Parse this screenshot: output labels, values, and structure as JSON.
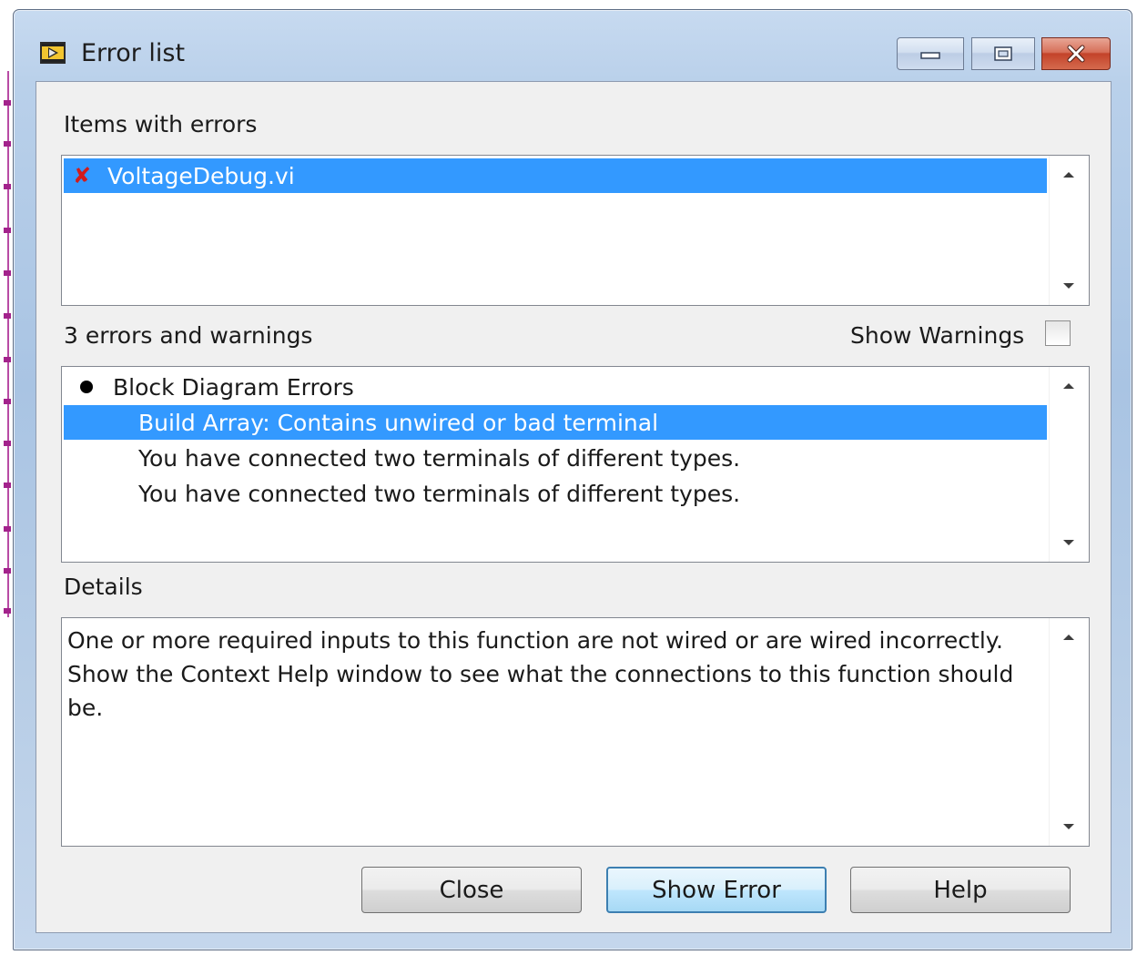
{
  "window": {
    "title": "Error list"
  },
  "items_section": {
    "label": "Items with errors",
    "items": [
      {
        "mark": "✘",
        "label": "VoltageDebug.vi"
      }
    ]
  },
  "errors_section": {
    "count_label": "3 errors and warnings",
    "show_warnings_label": "Show Warnings",
    "show_warnings_checked": false,
    "group_label": "Block Diagram Errors",
    "entries": [
      "Build Array: Contains unwired or bad terminal",
      "You have connected two terminals of different types.",
      "You have connected two terminals of different types."
    ]
  },
  "details_section": {
    "label": "Details",
    "text": "One or more required inputs to this function are not wired or are wired incorrectly.\nShow the Context Help window to see what the connections to this function should\nbe."
  },
  "buttons": {
    "close": "Close",
    "show_error": "Show Error",
    "help": "Help"
  },
  "colors": {
    "selection": "#3399ff",
    "error_mark": "#d21b1b",
    "close_button": "#c3432a"
  }
}
